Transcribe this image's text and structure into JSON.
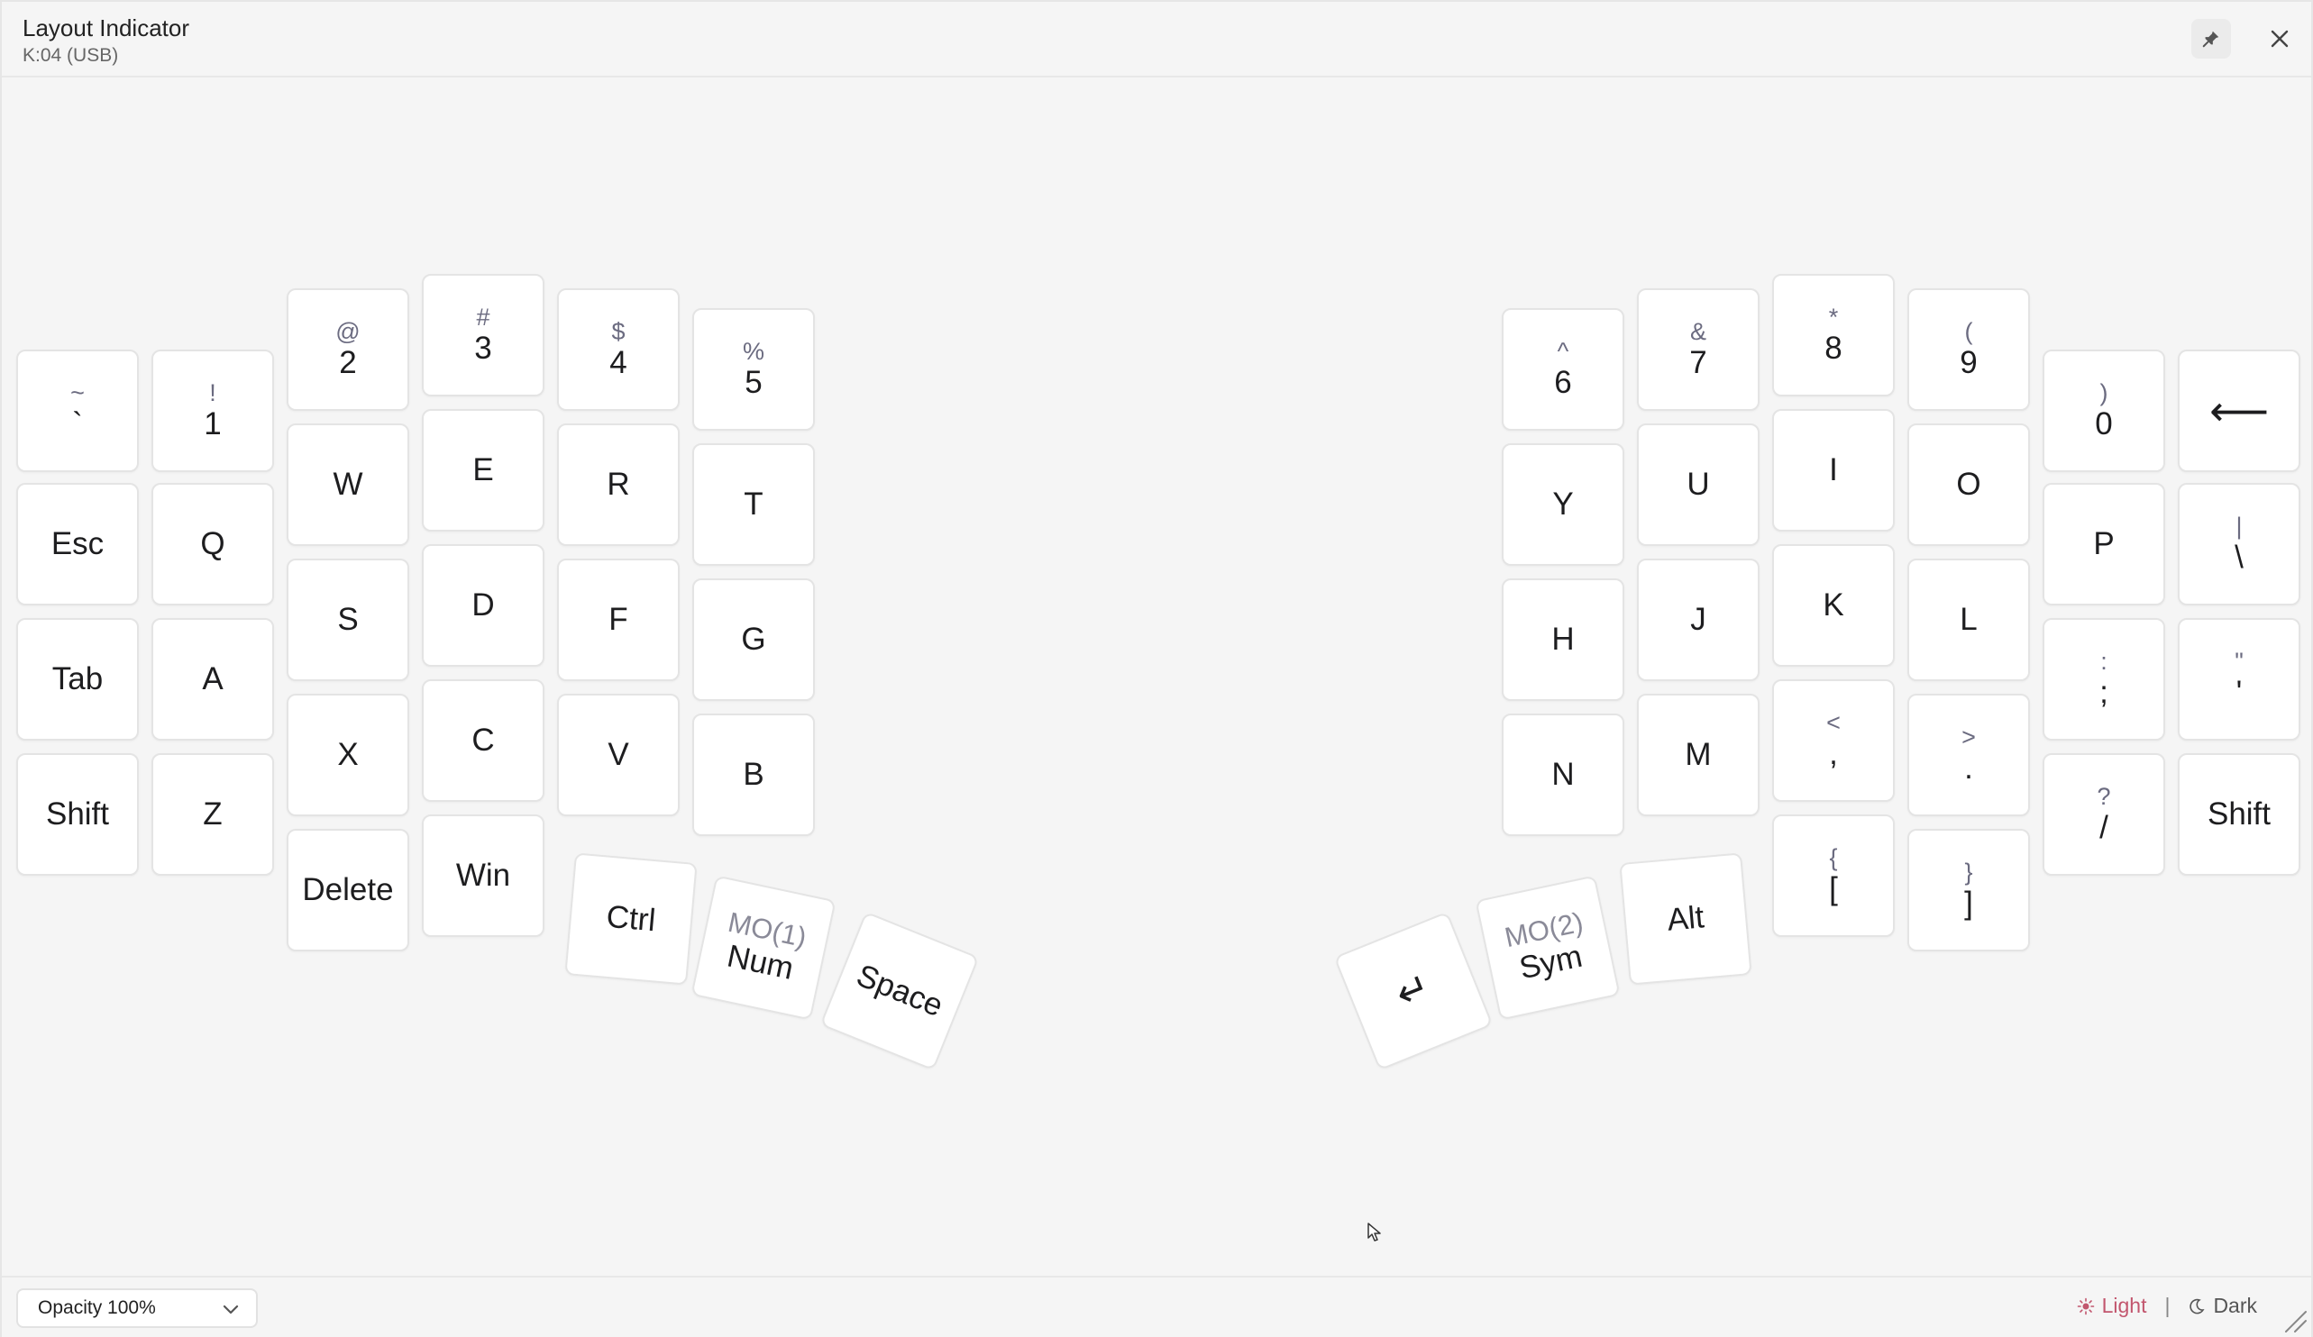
{
  "window": {
    "title": "Layout Indicator",
    "subtitle": "K:04 (USB)",
    "pin_icon": "pin-icon",
    "close_icon": "close-icon"
  },
  "keys": {
    "grave": {
      "shift": "~",
      "main": "`"
    },
    "k1": {
      "shift": "!",
      "main": "1"
    },
    "k2": {
      "shift": "@",
      "main": "2"
    },
    "k3": {
      "shift": "#",
      "main": "3"
    },
    "k4": {
      "shift": "$",
      "main": "4"
    },
    "k5": {
      "shift": "%",
      "main": "5"
    },
    "esc": {
      "main": "Esc"
    },
    "q": {
      "main": "Q"
    },
    "w": {
      "main": "W"
    },
    "e": {
      "main": "E"
    },
    "r": {
      "main": "R"
    },
    "t": {
      "main": "T"
    },
    "tab": {
      "main": "Tab"
    },
    "a": {
      "main": "A"
    },
    "s": {
      "main": "S"
    },
    "d": {
      "main": "D"
    },
    "f": {
      "main": "F"
    },
    "g": {
      "main": "G"
    },
    "lshift": {
      "main": "Shift"
    },
    "z": {
      "main": "Z"
    },
    "x": {
      "main": "X"
    },
    "c": {
      "main": "C"
    },
    "v": {
      "main": "V"
    },
    "b": {
      "main": "B"
    },
    "delete": {
      "main": "Delete"
    },
    "win": {
      "main": "Win"
    },
    "ctrl": {
      "main": "Ctrl"
    },
    "num": {
      "layer": "MO(1)",
      "main": "Num"
    },
    "space": {
      "main": "Space"
    },
    "k6": {
      "shift": "^",
      "main": "6"
    },
    "k7": {
      "shift": "&",
      "main": "7"
    },
    "k8": {
      "shift": "*",
      "main": "8"
    },
    "k9": {
      "shift": "(",
      "main": "9"
    },
    "k0": {
      "shift": ")",
      "main": "0"
    },
    "backspace": {
      "main": "⟵"
    },
    "y": {
      "main": "Y"
    },
    "u": {
      "main": "U"
    },
    "i": {
      "main": "I"
    },
    "o": {
      "main": "O"
    },
    "p": {
      "main": "P"
    },
    "backslash": {
      "shift": "|",
      "main": "\\"
    },
    "h": {
      "main": "H"
    },
    "j": {
      "main": "J"
    },
    "k": {
      "main": "K"
    },
    "l": {
      "main": "L"
    },
    "semicolon": {
      "shift": ":",
      "main": ";"
    },
    "quote": {
      "shift": "\"",
      "main": "'"
    },
    "n": {
      "main": "N"
    },
    "m": {
      "main": "M"
    },
    "comma": {
      "shift": "<",
      "main": ","
    },
    "period": {
      "shift": ">",
      "main": "."
    },
    "slash": {
      "shift": "?",
      "main": "/"
    },
    "rshift": {
      "main": "Shift"
    },
    "lbracket": {
      "shift": "{",
      "main": "["
    },
    "rbracket": {
      "shift": "}",
      "main": "]"
    },
    "alt": {
      "main": "Alt"
    },
    "sym": {
      "layer": "MO(2)",
      "main": "Sym"
    },
    "enter": {
      "main": "↵"
    }
  },
  "footer": {
    "opacity_label": "Opacity 100%",
    "light_label": "Light",
    "separator": "|",
    "dark_label": "Dark"
  },
  "colors": {
    "accent": "#c2566e",
    "background": "#f5f5f5",
    "key": "#ffffff"
  }
}
